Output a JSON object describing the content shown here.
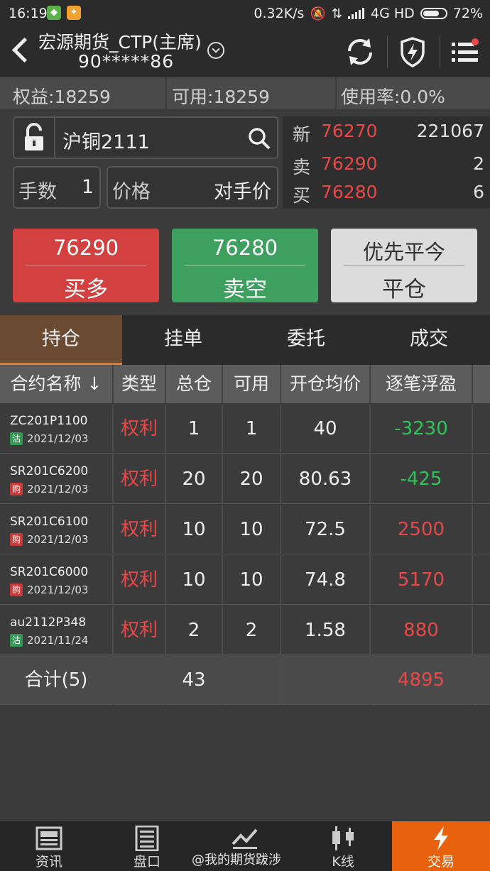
{
  "status": {
    "time": "16:19",
    "net_speed": "0.32K/s",
    "network": "4G HD",
    "battery": "72%",
    "battery_level": 0.72
  },
  "header": {
    "account_name": "宏源期货_CTP(主席)",
    "account_no": "90*****86"
  },
  "summary": {
    "equity": "权益:18259",
    "available": "可用:18259",
    "usage": "使用率:0.0%"
  },
  "order": {
    "symbol": "沪铜2111",
    "qty_label": "手数",
    "qty_value": "1",
    "price_label": "价格",
    "price_value": "对手价"
  },
  "quote": {
    "last_label": "新",
    "last_price": "76270",
    "last_volume": "221067",
    "ask_label": "卖",
    "ask_price": "76290",
    "ask_volume": "2",
    "bid_label": "买",
    "bid_price": "76280",
    "bid_volume": "6"
  },
  "buttons": {
    "buy_price": "76290",
    "buy_label": "买多",
    "sell_price": "76280",
    "sell_label": "卖空",
    "close_mode": "优先平今",
    "close_label": "平仓"
  },
  "tabs": [
    "持仓",
    "挂单",
    "委托",
    "成交"
  ],
  "table": {
    "headers": [
      "合约名称 ↓",
      "类型",
      "总仓",
      "可用",
      "开仓均价",
      "逐笔浮盈"
    ],
    "rows": [
      {
        "code": "ZC201P1100",
        "badge": "沽",
        "date": "2021/12/03",
        "type": "权利",
        "total": "1",
        "avail": "1",
        "avg": "40",
        "pnl": "-3230",
        "pnl_color": "green",
        "badge_color": "green"
      },
      {
        "code": "SR201C6200",
        "badge": "购",
        "date": "2021/12/03",
        "type": "权利",
        "total": "20",
        "avail": "20",
        "avg": "80.63",
        "pnl": "-425",
        "pnl_color": "green",
        "badge_color": "red"
      },
      {
        "code": "SR201C6100",
        "badge": "购",
        "date": "2021/12/03",
        "type": "权利",
        "total": "10",
        "avail": "10",
        "avg": "72.5",
        "pnl": "2500",
        "pnl_color": "red",
        "badge_color": "red"
      },
      {
        "code": "SR201C6000",
        "badge": "购",
        "date": "2021/12/03",
        "type": "权利",
        "total": "10",
        "avail": "10",
        "avg": "74.8",
        "pnl": "5170",
        "pnl_color": "red",
        "badge_color": "red"
      },
      {
        "code": "au2112P348",
        "badge": "沽",
        "date": "2021/11/24",
        "type": "权利",
        "total": "2",
        "avail": "2",
        "avg": "1.58",
        "pnl": "880",
        "pnl_color": "red",
        "badge_color": "green"
      }
    ],
    "total": {
      "label": "合计(5)",
      "total": "43",
      "pnl": "4895"
    }
  },
  "bottom_nav": [
    "资讯",
    "盘口",
    "走势",
    "K线",
    "交易"
  ],
  "watermark": "@我的期货跋涉",
  "colors": {
    "up": "#e84848",
    "down": "#31c25a",
    "accent": "#e8620e"
  }
}
